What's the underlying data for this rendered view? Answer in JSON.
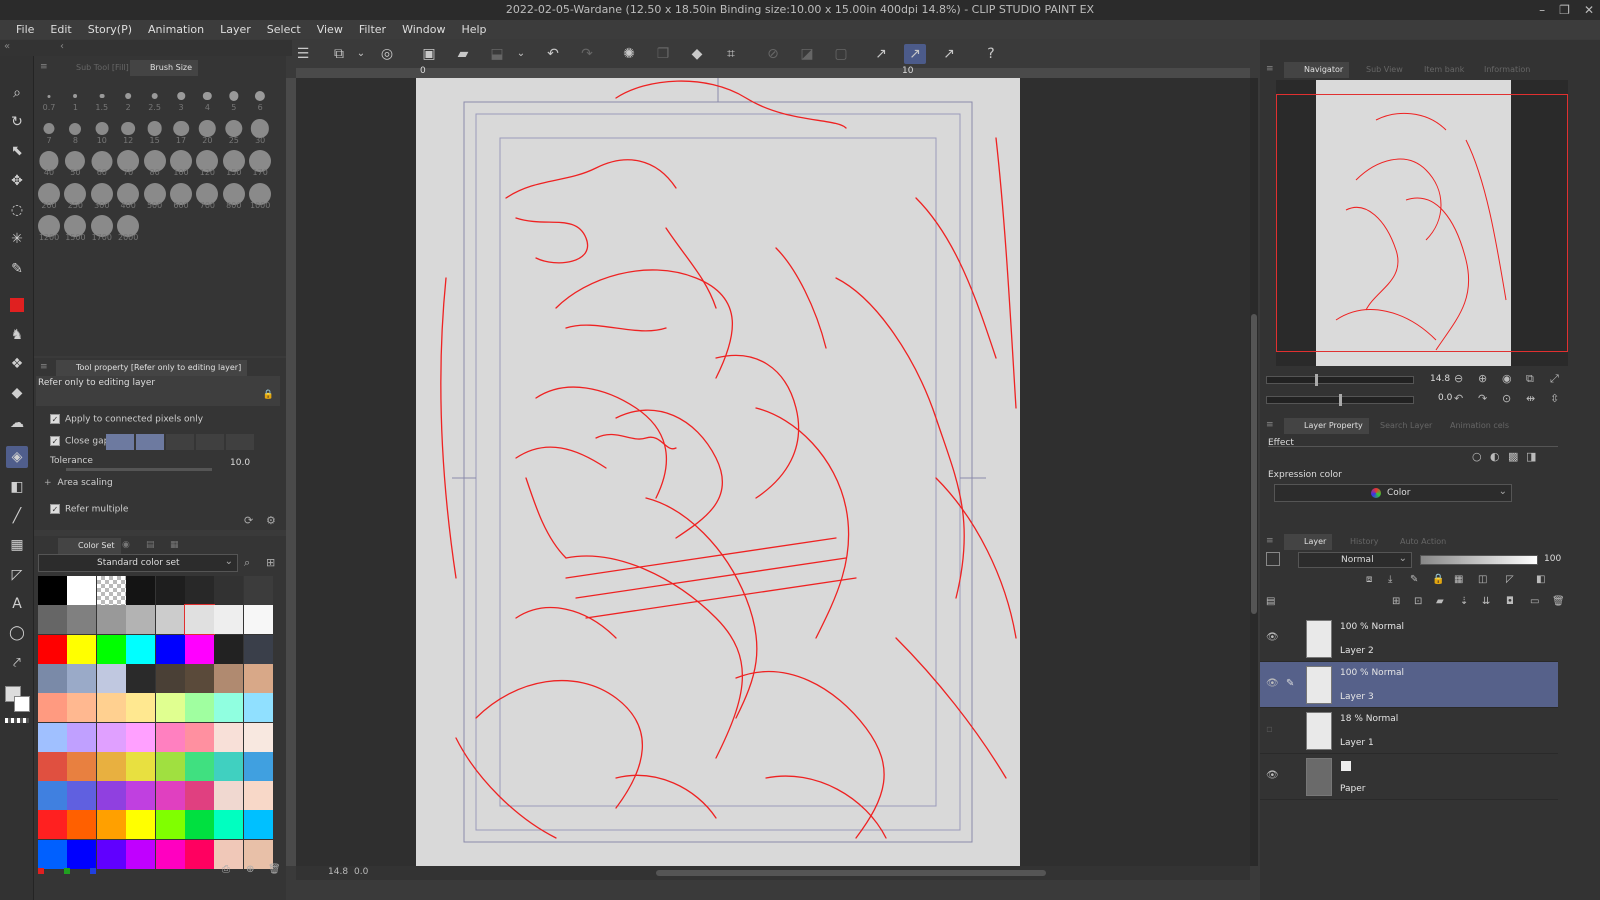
{
  "window": {
    "title": "2022-02-05-Wardane (12.50 x 18.50in Binding size:10.00 x 15.00in 400dpi 14.8%) - CLIP STUDIO PAINT EX",
    "controls": [
      "–",
      "❐",
      "✕"
    ]
  },
  "menu": [
    "File",
    "Edit",
    "Story(P)",
    "Animation",
    "Layer",
    "Select",
    "View",
    "Filter",
    "Window",
    "Help"
  ],
  "sub_tool": {
    "tab_inactive": "Sub Tool [Fill]",
    "tab_active": "Brush Size",
    "brush_sizes": [
      "0.7",
      "1",
      "1.5",
      "2",
      "2.5",
      "3",
      "4",
      "5",
      "6",
      "7",
      "8",
      "10",
      "12",
      "15",
      "17",
      "20",
      "25",
      "30",
      "40",
      "50",
      "60",
      "70",
      "80",
      "100",
      "120",
      "150",
      "170",
      "200",
      "250",
      "300",
      "400",
      "500",
      "600",
      "700",
      "800",
      "1000",
      "1200",
      "1500",
      "1700",
      "2000"
    ]
  },
  "tool_property": {
    "header": "Tool property [Refer only to editing layer]",
    "preview_label": "Refer only to editing layer",
    "apply_connected": "Apply to connected pixels only",
    "close_gap": "Close gap",
    "tolerance_label": "Tolerance",
    "tolerance_value": "10.0",
    "area_scaling": "Area scaling",
    "refer_multiple": "Refer multiple"
  },
  "color_set": {
    "tab": "Color Set",
    "set_name": "Standard color set",
    "swatches": [
      "#000000",
      "#ffffff",
      "checker",
      "#141414",
      "#1e1e1e",
      "#282828",
      "#323232",
      "#3c3c3c",
      "#666666",
      "#808080",
      "#999999",
      "#b3b3b3",
      "#cccccc",
      "#e0e0e0",
      "#eeeeee",
      "#f7f7f7",
      "#ff0000",
      "#ffff00",
      "#00ff00",
      "#00ffff",
      "#0000ff",
      "#ff00ff",
      "#222222",
      "#3a3f4a",
      "#7a8aa8",
      "#9aaac8",
      "#c0c8e0",
      "#2a2a2a",
      "#4a4036",
      "#5a4a3a",
      "#b08a70",
      "#d8a888",
      "#ff9a80",
      "#ffb890",
      "#ffd090",
      "#ffe890",
      "#e0ff90",
      "#a0ffa0",
      "#90ffe0",
      "#90e0ff",
      "#a0c0ff",
      "#c0a0ff",
      "#e0a0ff",
      "#ffa0ff",
      "#ff80c0",
      "#ff90a0",
      "#f8e0d8",
      "#f8e8e0",
      "#e05040",
      "#e88040",
      "#e8b040",
      "#e8e040",
      "#a0e040",
      "#40e080",
      "#40d0c0",
      "#40a0e0",
      "#4080e0",
      "#6060e0",
      "#9040e0",
      "#c040e0",
      "#e040c0",
      "#e04080",
      "#f0d8d0",
      "#f8d8c8",
      "#ff2020",
      "#ff6000",
      "#ffa000",
      "#ffff00",
      "#80ff00",
      "#00e040",
      "#00ffc0",
      "#00c0ff",
      "#0060ff",
      "#0000ff",
      "#6000ff",
      "#c000ff",
      "#ff00c0",
      "#ff0060",
      "#f0c8b8",
      "#e8c0a8"
    ]
  },
  "status": {
    "zoom": "14.8",
    "rotation": "0.0"
  },
  "ruler": {
    "mark_0": "0",
    "mark_10": "10"
  },
  "navigator": {
    "tabs": [
      "Navigator",
      "Sub View",
      "Item bank",
      "Information"
    ],
    "zoom": "14.8",
    "angle": "0.0"
  },
  "layer_property": {
    "tabs": [
      "Layer Property",
      "Search Layer",
      "Animation cels"
    ],
    "effect_label": "Effect",
    "expression_label": "Expression color",
    "expression_value": "Color"
  },
  "layer_panel": {
    "tabs": [
      "Layer",
      "History",
      "Auto Action"
    ],
    "blend_mode": "Normal",
    "opacity": "100",
    "layers": [
      {
        "mode": "100 % Normal",
        "name": "Layer 2",
        "visible": true,
        "selected": false
      },
      {
        "mode": "100 % Normal",
        "name": "Layer 3",
        "visible": true,
        "selected": true
      },
      {
        "mode": "18 % Normal",
        "name": "Layer 1",
        "visible": false,
        "selected": false
      },
      {
        "mode": "",
        "name": "Paper",
        "visible": true,
        "selected": false
      }
    ]
  },
  "colors": {
    "accent": "#56618a",
    "sketch": "#ee2222",
    "main_color": "#e02020"
  }
}
